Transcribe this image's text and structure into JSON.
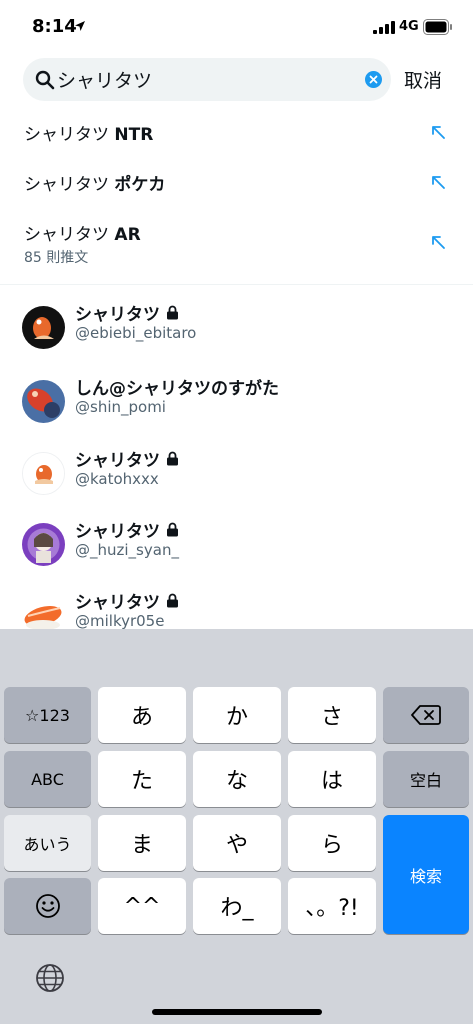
{
  "status": {
    "time": "8:14",
    "network": "4G"
  },
  "search": {
    "query": "シャリタツ",
    "cancel_label": "取消"
  },
  "suggestions": [
    {
      "prefix": "シャリタツ ",
      "suffix": "NTR",
      "sub": ""
    },
    {
      "prefix": "シャリタツ ",
      "suffix": "ポケカ",
      "sub": ""
    },
    {
      "prefix": "シャリタツ ",
      "suffix": "AR",
      "sub": "85 則推文"
    }
  ],
  "users": [
    {
      "name": "シャリタツ",
      "handle": "@ebiebi_ebitaro",
      "locked": true,
      "avatar": "black-orange"
    },
    {
      "name": "しん@シャリタツのすがた",
      "handle": "@shin_pomi",
      "locked": false,
      "avatar": "red-blue"
    },
    {
      "name": "シャリタツ",
      "handle": "@katohxxx",
      "locked": true,
      "avatar": "white-orange"
    },
    {
      "name": "シャリタツ",
      "handle": "@_huzi_syan_",
      "locked": true,
      "avatar": "purple"
    },
    {
      "name": "シャリタツ",
      "handle": "@milkyr05e",
      "locked": true,
      "avatar": "sushi"
    }
  ],
  "keyboard": {
    "row1": [
      "☆123",
      "あ",
      "か",
      "さ"
    ],
    "row2": [
      "ABC",
      "た",
      "な",
      "は",
      "空白"
    ],
    "row3": [
      "あいう",
      "ま",
      "や",
      "ら"
    ],
    "row4": [
      "^^",
      "わ_",
      "、。?!"
    ],
    "search_key": "検索"
  },
  "colors": {
    "accent": "#1d9bf0",
    "keyboard_bg": "#d1d4da",
    "search_key": "#0a84ff"
  }
}
